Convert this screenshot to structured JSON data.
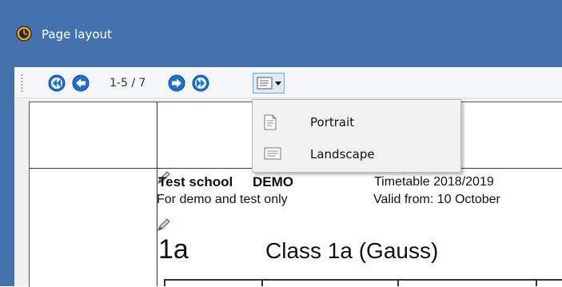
{
  "window": {
    "title": "Page layout"
  },
  "toolbar": {
    "page_indicator": "1-5 / 7"
  },
  "orientation_menu": {
    "items": [
      {
        "label": "Portrait"
      },
      {
        "label": "Landscape"
      }
    ]
  },
  "preview": {
    "school_name": "Test school",
    "demo_label": "DEMO",
    "timetable_label": "Timetable 2018/2019",
    "demo_note": "For demo and test only",
    "valid_from": "Valid from: 10 October",
    "class_code": "1a",
    "class_title": "Class 1a (Gauss)"
  },
  "colors": {
    "titlebar": "#4372ac",
    "nav_icon": "#1f6fd1",
    "menu_bg": "#f2f2f2"
  }
}
